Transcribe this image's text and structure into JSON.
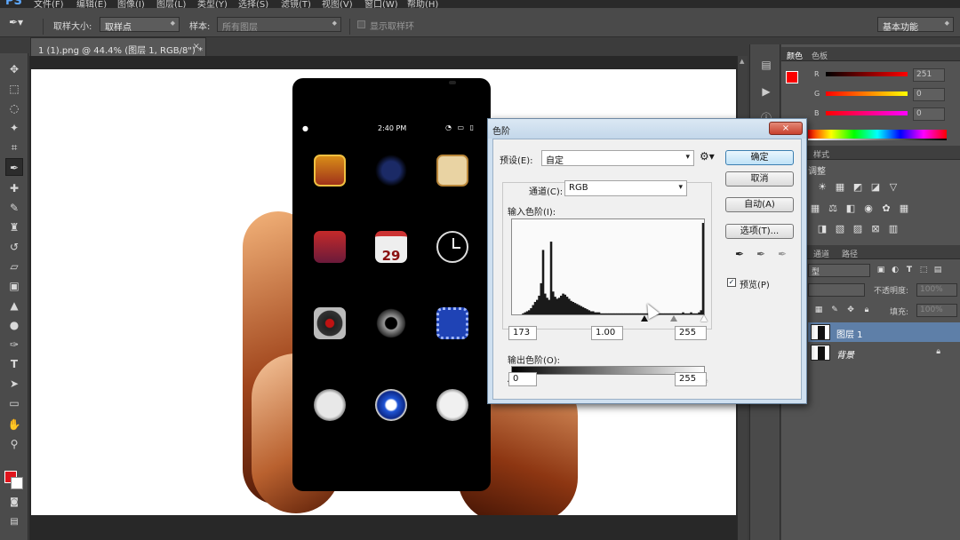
{
  "menubar": {
    "logo": "PS",
    "items": [
      "文件(F)",
      "编辑(E)",
      "图像(I)",
      "图层(L)",
      "类型(Y)",
      "选择(S)",
      "滤镜(T)",
      "视图(V)",
      "窗口(W)",
      "帮助(H)"
    ]
  },
  "options": {
    "sample_size_label": "取样大小:",
    "sample_size_value": "取样点",
    "sample_label": "样本:",
    "sample_value": "所有图层",
    "show_ring_label": "显示取样环",
    "workspace": "基本功能"
  },
  "document": {
    "tab_title": "1 (1).png @ 44.4% (图层 1, RGB/8\") *",
    "close": "×"
  },
  "phone": {
    "time": "2:40 PM",
    "status_icons": "◔ ▭ ▯",
    "calendar_day": "29"
  },
  "color_panel": {
    "tabs": [
      "颜色",
      "色板"
    ],
    "r_label": "R",
    "g_label": "G",
    "b_label": "B",
    "r_value": "251",
    "g_value": "0",
    "b_value": "0"
  },
  "adjustments_panel": {
    "tabs": [
      "样式"
    ],
    "title": "调整"
  },
  "layers_panel": {
    "tabs": [
      "通道",
      "路径"
    ],
    "filter_label": "型",
    "opacity_label": "不透明度:",
    "opacity_value": "100%",
    "fill_label": "填充:",
    "fill_value": "100%",
    "layers": [
      {
        "name": "图层 1"
      },
      {
        "name": "背景"
      }
    ]
  },
  "levels_dialog": {
    "title": "色阶",
    "close": "×",
    "preset_label": "预设(E):",
    "preset_value": "自定",
    "channel_label": "通道(C):",
    "channel_value": "RGB",
    "input_label": "输入色阶(I):",
    "input_black": "173",
    "input_gamma": "1.00",
    "input_white": "255",
    "output_label": "输出色阶(O):",
    "output_black": "0",
    "output_white": "255",
    "buttons": {
      "ok": "确定",
      "cancel": "取消",
      "auto": "自动(A)",
      "options": "选项(T)..."
    },
    "preview_label": "预览(P)",
    "preview_checked": "✓",
    "histogram": [
      0,
      0,
      0,
      0,
      0,
      1,
      2,
      3,
      4,
      6,
      9,
      12,
      14,
      18,
      30,
      62,
      20,
      16,
      14,
      70,
      22,
      17,
      15,
      16,
      18,
      20,
      19,
      17,
      15,
      13,
      12,
      11,
      10,
      9,
      8,
      7,
      6,
      5,
      4,
      3,
      3,
      2,
      2,
      2,
      1,
      1,
      1,
      1,
      1,
      1,
      1,
      1,
      1,
      1,
      1,
      1,
      1,
      1,
      1,
      1,
      1,
      1,
      1,
      1,
      1,
      1,
      1,
      1,
      1,
      1,
      1,
      1,
      1,
      1,
      1,
      1,
      1,
      1,
      1,
      1,
      1,
      1,
      1,
      1,
      1,
      2,
      1,
      1,
      1,
      2,
      1,
      1,
      1,
      2,
      4,
      88
    ]
  }
}
